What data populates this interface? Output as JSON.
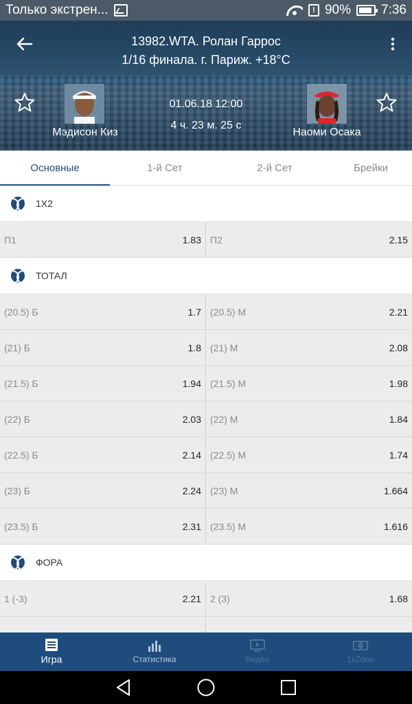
{
  "status_bar": {
    "notification_text": "Только экстрен...",
    "battery": "90%",
    "time": "7:36"
  },
  "header": {
    "tournament": "13982.WTA. Ролан Гаррос",
    "round_info": "1/16 финала. г. Париж. +18°C",
    "date_time": "01.06.18 12:00",
    "duration": "4 ч. 23 м. 25 с",
    "player1": {
      "name": "Мэдисон Киз"
    },
    "player2": {
      "name": "Наоми Осака"
    }
  },
  "tabs": [
    {
      "label": "Основные",
      "active": true
    },
    {
      "label": "1-й Сет"
    },
    {
      "label": "2-й Сет"
    },
    {
      "label": "Брейки"
    }
  ],
  "sections": [
    {
      "title": "1X2",
      "rows": [
        {
          "left_label": "П1",
          "left_value": "1.83",
          "right_label": "П2",
          "right_value": "2.15"
        }
      ]
    },
    {
      "title": "ТОТАЛ",
      "rows": [
        {
          "left_label": "(20.5) Б",
          "left_value": "1.7",
          "right_label": "(20.5) М",
          "right_value": "2.21"
        },
        {
          "left_label": "(21) Б",
          "left_value": "1.8",
          "right_label": "(21) М",
          "right_value": "2.08"
        },
        {
          "left_label": "(21.5) Б",
          "left_value": "1.94",
          "right_label": "(21.5) М",
          "right_value": "1.98"
        },
        {
          "left_label": "(22) Б",
          "left_value": "2.03",
          "right_label": "(22) М",
          "right_value": "1.84"
        },
        {
          "left_label": "(22.5) Б",
          "left_value": "2.14",
          "right_label": "(22.5) М",
          "right_value": "1.74"
        },
        {
          "left_label": "(23) Б",
          "left_value": "2.24",
          "right_label": "(23) М",
          "right_value": "1.664"
        },
        {
          "left_label": "(23.5) Б",
          "left_value": "2.31",
          "right_label": "(23.5) М",
          "right_value": "1.616"
        }
      ]
    },
    {
      "title": "ФОРА",
      "rows": [
        {
          "left_label": "1 (-3)",
          "left_value": "2.21",
          "right_label": "2 (3)",
          "right_value": "1.68"
        },
        {
          "left_label": "",
          "left_value": "",
          "right_label": "",
          "right_value": ""
        }
      ]
    }
  ],
  "bottom_nav": [
    {
      "label": "Игра",
      "icon": "list-icon"
    },
    {
      "label": "Статистика",
      "icon": "bar-chart-icon"
    },
    {
      "label": "Видео",
      "icon": "video-icon"
    },
    {
      "label": "1xZone",
      "icon": "zone-icon"
    }
  ],
  "colors": {
    "primary": "#1e4c7c",
    "status_bar": "#4b5a66"
  }
}
